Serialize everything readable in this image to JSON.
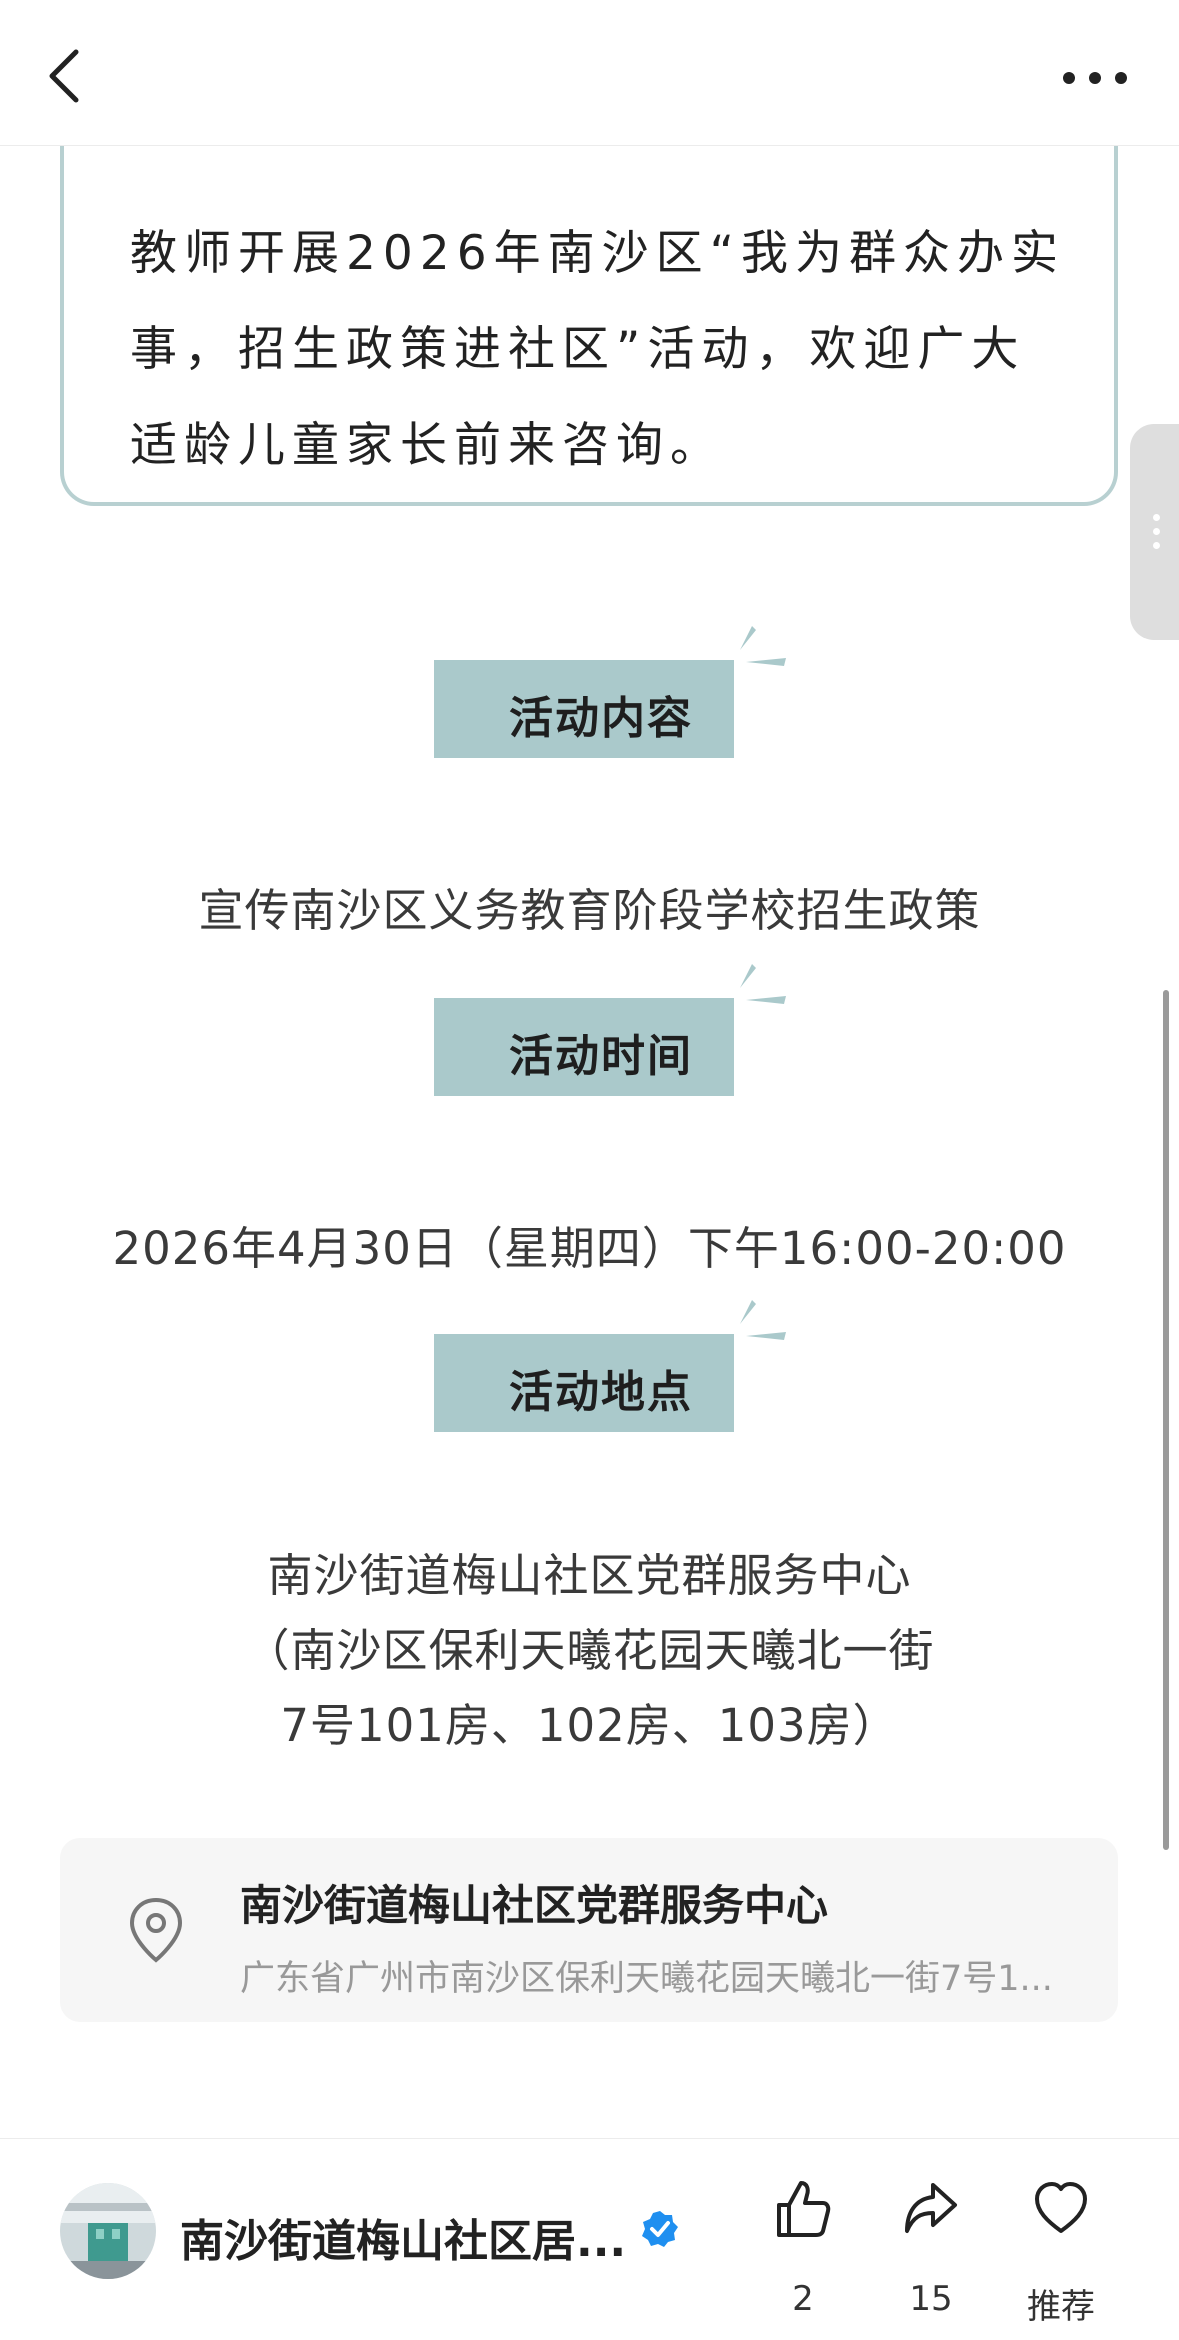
{
  "intro": {
    "line1": "教师开展2026年南沙区“我为群众办实",
    "line2": "事，招生政策进社区”活动，欢迎广大",
    "line3": "适龄儿童家长前来咨询。"
  },
  "sections": {
    "content": {
      "title": "活动内容",
      "body": "宣传南沙区义务教育阶段学校招生政策"
    },
    "time": {
      "title": "活动时间",
      "body": "2026年4月30日（星期四）下午16:00-20:00"
    },
    "venue": {
      "title": "活动地点",
      "line1": "南沙街道梅山社区党群服务中心",
      "line2": "（南沙区保利天曦花园天曦北一街",
      "line3": "7号101房、102房、103房）"
    }
  },
  "location_card": {
    "name": "南沙街道梅山社区党群服务中心",
    "address": "广东省广州市南沙区保利天曦花园天曦北一街7号1..."
  },
  "author": {
    "name": "南沙街道梅山社区居..."
  },
  "actions": {
    "like_count": "2",
    "share_count": "15",
    "recommend_label": "推荐"
  },
  "colors": {
    "accent": "#aac9cb",
    "card_border": "#b8d0d1",
    "verified": "#1f8ff0"
  },
  "icons": [
    "back-arrow-icon",
    "more-icon",
    "location-pin-icon",
    "verified-icon",
    "thumbs-up-icon",
    "share-icon",
    "heart-icon"
  ]
}
